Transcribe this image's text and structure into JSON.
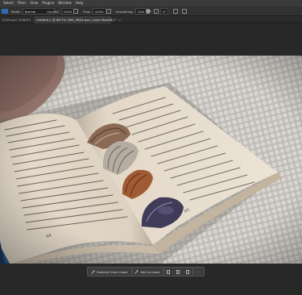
{
  "menubar": {
    "items": [
      "Select",
      "Filter",
      "View",
      "Plugins",
      "Window",
      "Help"
    ]
  },
  "options_bar": {
    "mode_label": "Mode:",
    "mode_value": "Normal",
    "opacity_label": "Opacity:",
    "opacity_value": "100%",
    "flow_label": "Flow:",
    "flow_value": "100%",
    "smoothing_label": "Smoothing:",
    "smoothing_value": "10%",
    "angle_value": "0°",
    "colors": {
      "brush_swatch": "#2f6db5"
    }
  },
  "tabs": [
    {
      "label": "0939.psd, RGB/8*)",
      "close": "×"
    },
    {
      "label": "Untitled-1 @ 66.7% (IMG_9834.psd, Layer Mask/8) *",
      "close": "×"
    }
  ],
  "taskbar": {
    "subtract_label": "Subtract from mask",
    "add_label": "Add to mask",
    "more_label": "···"
  },
  "photo": {
    "page_number_left": "64",
    "page_number_right": "65"
  }
}
